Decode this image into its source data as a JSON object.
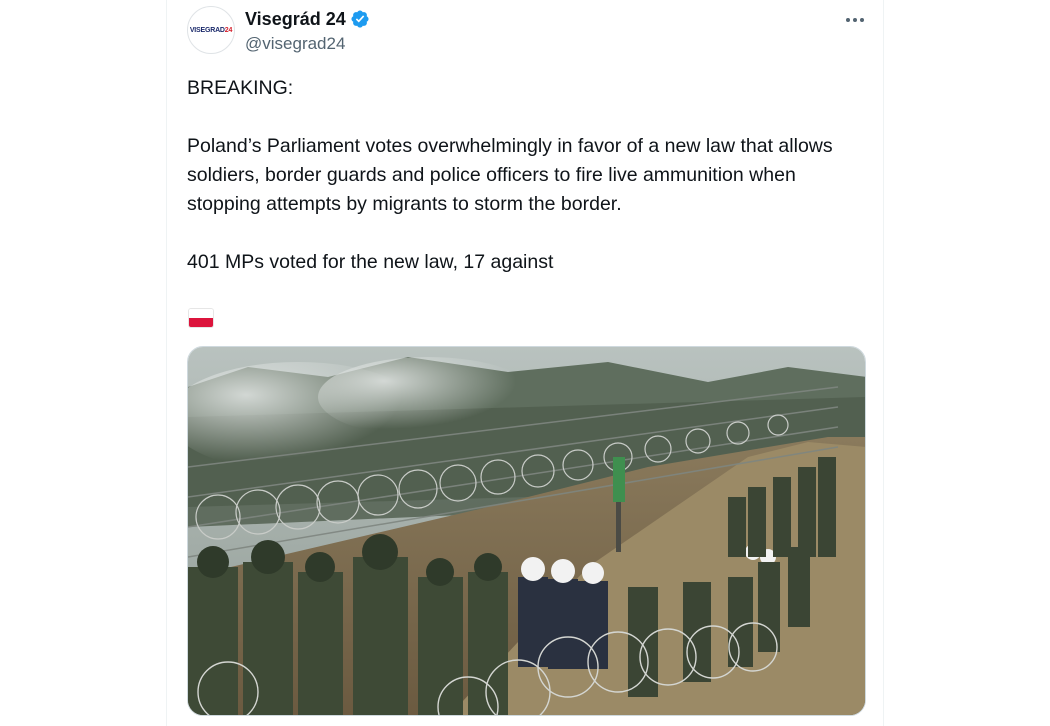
{
  "tweet": {
    "author": {
      "display_name": "Visegrád 24",
      "handle": "@visegrad24",
      "avatar_text_main": "VISEGRAD",
      "avatar_text_accent": "24",
      "verified": true
    },
    "text": {
      "line_breaking": "BREAKING:",
      "paragraph_main": "Poland’s Parliament votes overwhelmingly in favor of a new law that allows soldiers, border guards and police officers to fire live ammunition when stopping attempts by migrants to storm the border.",
      "paragraph_votes": "401 MPs voted for the new law, 17 against"
    },
    "flag_icon": "poland-flag-icon",
    "media": {
      "type": "photo"
    }
  },
  "icons": {
    "verified": "verified-badge-icon",
    "more": "more-options-icon"
  },
  "colors": {
    "verified_blue": "#1d9bf0",
    "text_primary": "#0f1419",
    "text_secondary": "#536471",
    "flag_red": "#dc143c"
  }
}
